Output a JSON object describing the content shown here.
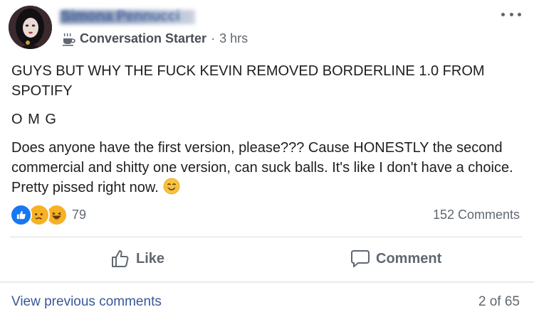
{
  "author": {
    "name": "Simona Pennucci",
    "badge_icon": "coffee-cup-icon",
    "badge_label": "Conversation Starter",
    "separator": "·",
    "timestamp": "3 hrs"
  },
  "post": {
    "lines": [
      "GUYS BUT WHY THE FUCK KEVIN REMOVED BORDERLINE 1.0 FROM SPOTIFY",
      "O M G",
      "Does anyone have the first version, please??? Cause HONESTLY the second commercial and shitty one version, can suck balls. It's like I don't have a choice. Pretty pissed right now."
    ],
    "emoji": "smiling-face-icon"
  },
  "reactions": {
    "icons": [
      "like-reaction-icon",
      "sad-reaction-icon",
      "haha-reaction-icon"
    ],
    "count": "79"
  },
  "comments_count": "152 Comments",
  "actions": {
    "like_label": "Like",
    "comment_label": "Comment"
  },
  "footer": {
    "view_previous": "View previous comments",
    "page_count": "2 of 65"
  },
  "colors": {
    "link_blue": "#385898",
    "like_blue": "#1877f2",
    "secondary_text": "#606770"
  }
}
